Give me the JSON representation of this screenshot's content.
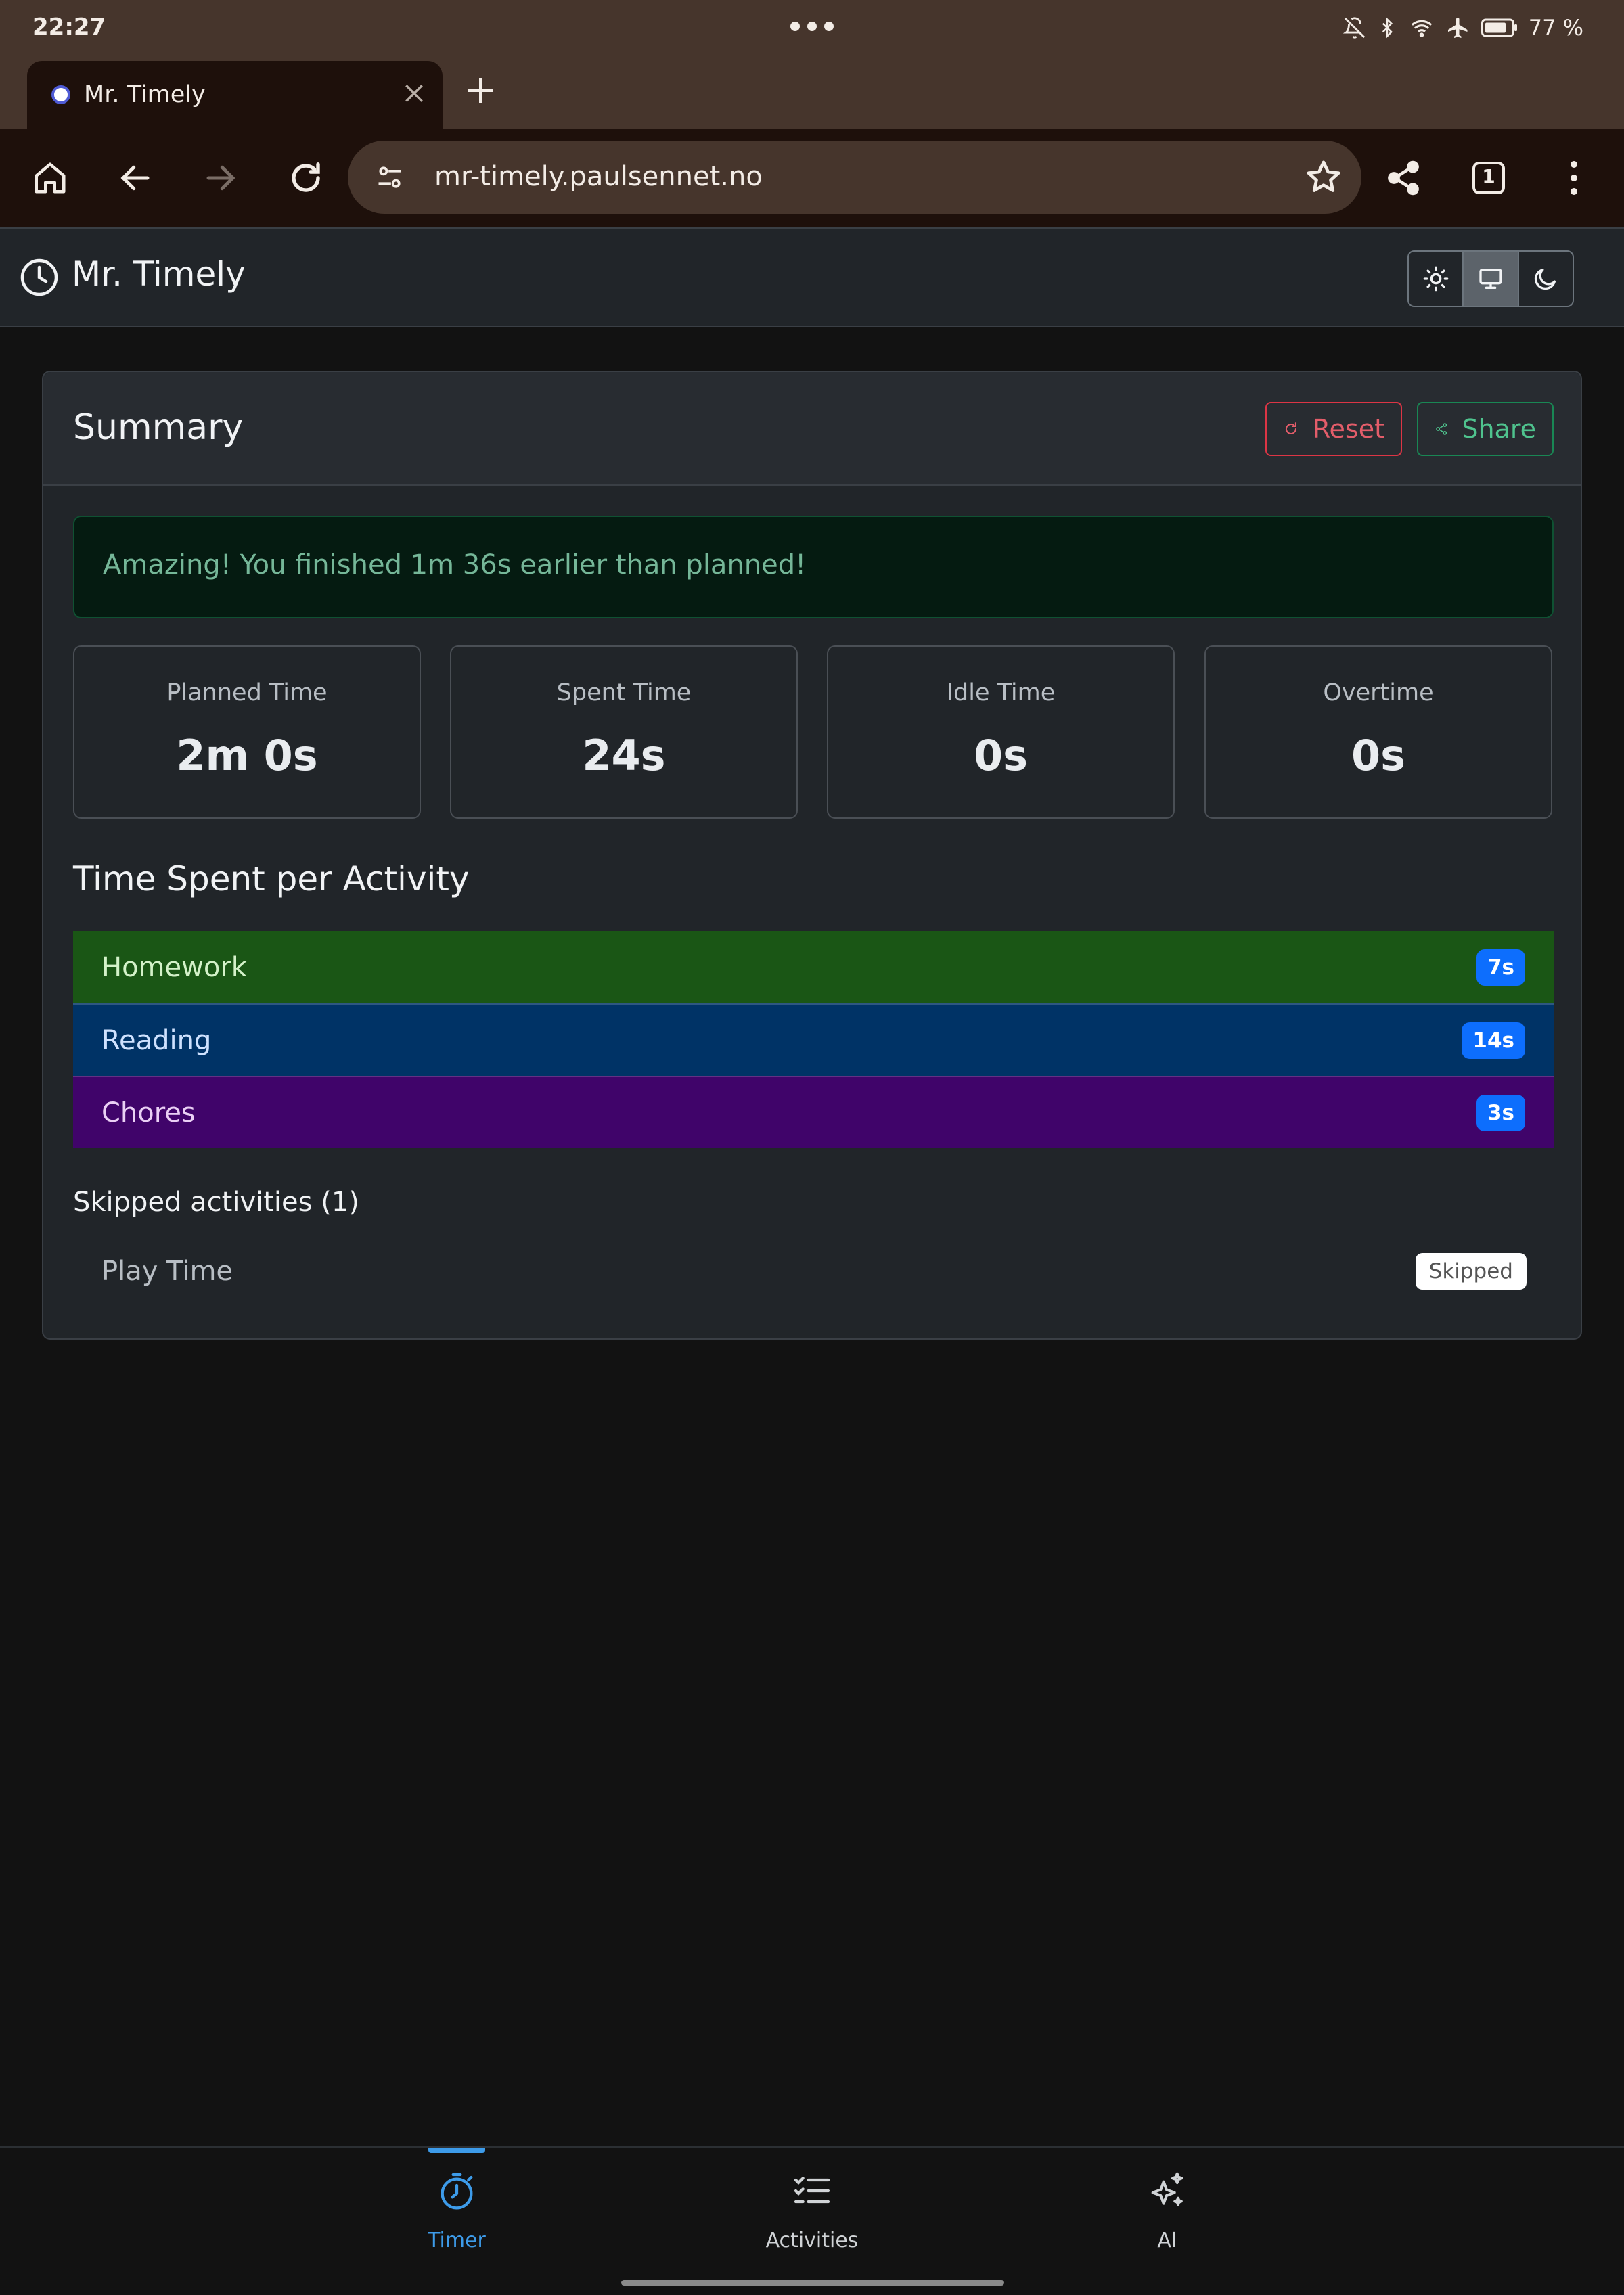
{
  "status_bar": {
    "time": "22:27",
    "battery": "77 %"
  },
  "browser": {
    "tab_title": "Mr. Timely",
    "url": "mr-timely.paulsennet.no",
    "tab_count": "1"
  },
  "app": {
    "title": "Mr. Timely",
    "theme_options": [
      "light",
      "auto",
      "dark"
    ],
    "active_theme": "auto"
  },
  "summary": {
    "title": "Summary",
    "reset_label": "Reset",
    "share_label": "Share",
    "alert": "Amazing! You finished 1m 36s earlier than planned!",
    "stats": [
      {
        "label": "Planned Time",
        "value": "2m 0s"
      },
      {
        "label": "Spent Time",
        "value": "24s"
      },
      {
        "label": "Idle Time",
        "value": "0s"
      },
      {
        "label": "Overtime",
        "value": "0s"
      }
    ],
    "section_title": "Time Spent per Activity",
    "activities": [
      {
        "name": "Homework",
        "time": "7s",
        "color": "#1a5615",
        "text_color": "#d4f2c9"
      },
      {
        "name": "Reading",
        "time": "14s",
        "color": "#003366",
        "text_color": "#cfe2ff"
      },
      {
        "name": "Chores",
        "time": "3s",
        "color": "#40046a",
        "text_color": "#ead0f5"
      }
    ],
    "skipped_title": "Skipped activities (1)",
    "skipped": [
      {
        "name": "Play Time",
        "badge": "Skipped"
      }
    ]
  },
  "bottom_nav": {
    "items": [
      {
        "label": "Timer",
        "active": true
      },
      {
        "label": "Activities",
        "active": false
      },
      {
        "label": "AI",
        "active": false
      }
    ],
    "active_color": "#3d9be9",
    "inactive_color": "#d0d3d6"
  }
}
